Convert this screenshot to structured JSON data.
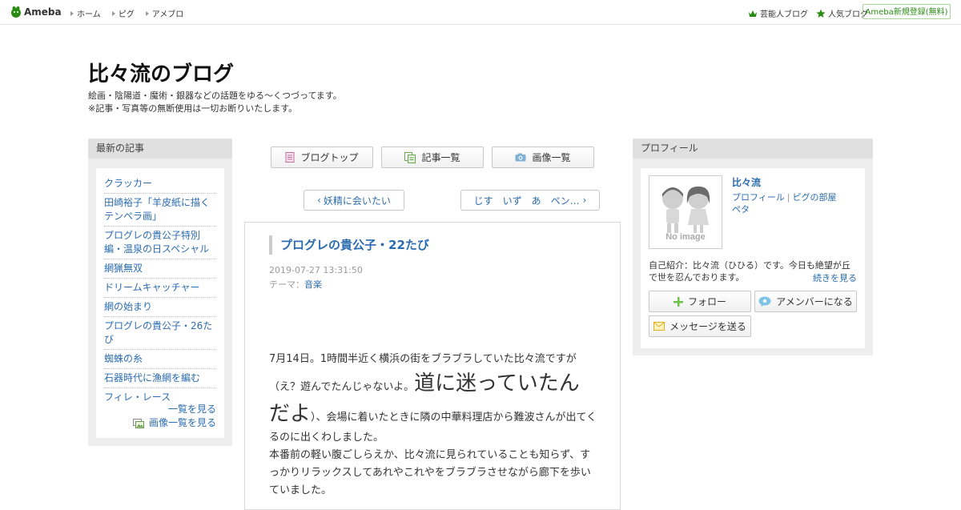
{
  "topbar": {
    "logo": "Ameba",
    "nav": [
      "ホーム",
      "ピグ",
      "アメブロ"
    ],
    "right_links": [
      "芸能人ブログ",
      "人気ブログ"
    ],
    "register": "Ameba新規登録(無料)"
  },
  "blog": {
    "title": "比々流のブログ",
    "description_1": "絵画・陰陽道・魔術・銀器などの話題をゆる～くつづってます。",
    "description_2": "※記事・写真等の無断使用は一切お断りいたします。"
  },
  "left": {
    "heading": "最新の記事",
    "recent": [
      "クラッカー",
      "田崎裕子「羊皮紙に描くテンペラ画」",
      "プログレの貴公子特別編・温泉の日スペシャル",
      "網猟無双",
      "ドリームキャッチャー",
      "網の始まり",
      "プログレの貴公子・26たび",
      "蜘蛛の糸",
      "石器時代に漁網を編む",
      "フィレ・レース"
    ],
    "list_link": "一覧を見る",
    "image_list_link": "画像一覧を見る"
  },
  "center": {
    "buttons": [
      "ブログトップ",
      "記事一覧",
      "画像一覧"
    ],
    "prev": "妖精に会いたい",
    "next": "じす　いず　あ　ペン…"
  },
  "article": {
    "title": "プログレの貴公子・22たび",
    "date": "2019-07-27 13:31:50",
    "theme_label": "テーマ：",
    "theme": "音楽",
    "body_1": "7月14日。1時間半近く横浜の街をブラブラしていた比々流ですが（え？遊んでたんじゃないよ。",
    "body_big": "道に迷っていたんだよ",
    "body_2": "）、会場に着いたときに隣の中華料理店から難波さんが出てくるのに出くわしました。",
    "body_3": "本番前の軽い腹ごしらえか、比々流に見られていることも知らず、すっかりリラックスしてあれやこれやをブラブラさせながら廊下を歩いていました。"
  },
  "profile": {
    "heading": "プロフィール",
    "name": "比々流",
    "profile_link": "プロフィール",
    "room_link": "ピグの部屋",
    "peta": "ペタ",
    "intro": "自己紹介：比々流（ひひる）です。今日も絶望が丘で世を忍んでおります。",
    "more": "続きを見る",
    "follow": "フォロー",
    "amember": "アメンバーになる",
    "message": "メッセージを送る",
    "noimage_text": "No image"
  },
  "colors": {
    "link": "#2b6cb0",
    "ameba_green": "#2b8c14",
    "column_bg": "#eeeeee"
  }
}
